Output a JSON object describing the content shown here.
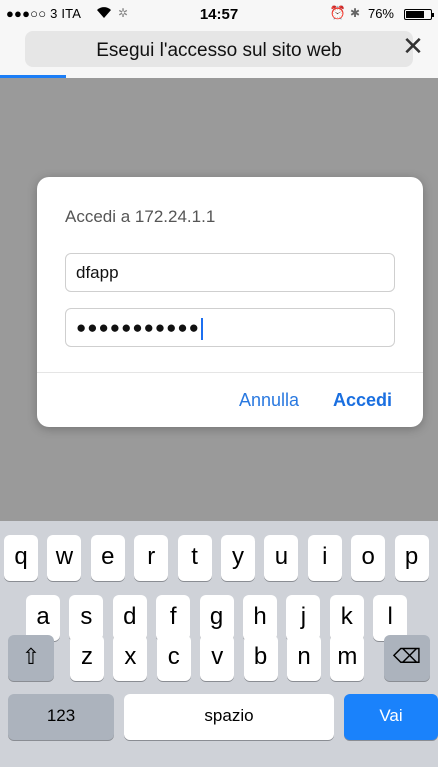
{
  "status_bar": {
    "carrier": "●●●○○ 3 ITA",
    "time": "14:57",
    "battery_text": "76%",
    "battery_level": 0.76,
    "icons": [
      "wifi-icon",
      "activity-spinner-icon",
      "alarm-icon",
      "bluetooth-icon",
      "battery-icon"
    ]
  },
  "browser": {
    "title": "Esegui l'accesso sul sito web",
    "close_label": "✕",
    "load_progress": 0.15
  },
  "dialog": {
    "title": "Accedi a 172.24.1.1",
    "username_value": "dfapp",
    "password_mask": "●●●●●●●●●●●",
    "cancel_label": "Annulla",
    "ok_label": "Accedi"
  },
  "keyboard": {
    "row1": [
      "q",
      "w",
      "e",
      "r",
      "t",
      "y",
      "u",
      "i",
      "o",
      "p"
    ],
    "row2": [
      "a",
      "s",
      "d",
      "f",
      "g",
      "h",
      "j",
      "k",
      "l"
    ],
    "row3": [
      "z",
      "x",
      "c",
      "v",
      "b",
      "n",
      "m"
    ],
    "shift_icon": "shift-icon",
    "shift_glyph": "⇧",
    "backspace_icon": "backspace-icon",
    "backspace_glyph": "⌫",
    "numbers_label": "123",
    "space_label": "spazio",
    "go_label": "Vai"
  },
  "colors": {
    "accent": "#1a82fb",
    "overlay": "#9a9a9a"
  }
}
